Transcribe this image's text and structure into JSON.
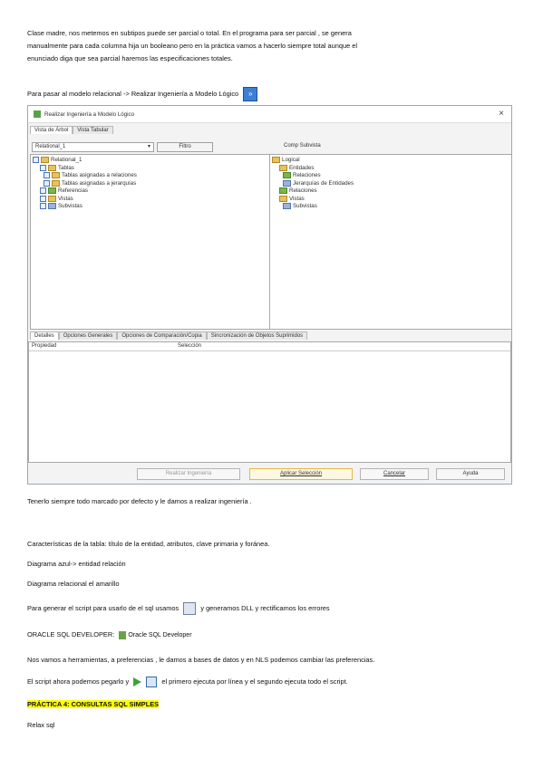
{
  "intro": [
    "Clase madre, nos metemos en subtipos puede ser parcial o total. En el programa para ser parcial , se genera",
    "manualmente para cada columna hija un booleano pero en la práctica vamos a hacerlo siempre total aunque el",
    "enunciado diga que sea parcial haremos las especificaciones totales."
  ],
  "relational_line": "Para pasar al modelo relacional -> Realizar Ingeniería a Modelo Lógico",
  "dialog": {
    "title": "Realizar Ingeniería a Modelo Lógico",
    "close": "×",
    "top_tabs": [
      "Vista de Árbol",
      "Vista Tabular"
    ],
    "left_select": "Relational_1",
    "filter_button": "Filtro",
    "compare_label": "Comp Subvista",
    "left_tree": [
      "Relational_1",
      "Tablas",
      "Tablas asignadas a relaciones",
      "Tablas asignadas a jerarquías",
      "Referencias",
      "Vistas",
      "Subvistas"
    ],
    "right_tree": [
      "Logical",
      "Entidades",
      "Relaciones",
      "Jerarquías de Entidades",
      "Relaciones",
      "Vistas",
      "Subvistas"
    ],
    "bottom_tabs": [
      "Detalles",
      "Opciones Generales",
      "Opciones de Comparación/Copia",
      "Sincronización de Objetos Suprimidos"
    ],
    "col_property": "Propiedad",
    "col_selection": "Selección",
    "buttons": [
      "Realizar Ingeniería",
      "Aplicar Selección",
      "Cancelar",
      "Ayuda"
    ]
  },
  "lines": [
    "Tenerlo siempre todo marcado por defecto y le damos a realizar ingeniería .",
    "Características de la tabla: título de la entidad, atributos, clave primaria y foránea.",
    "Diagrama azul-> entidad relación",
    "Diagrama relacional el amarillo"
  ],
  "script_line_a": "Para generar el script para usarlo de el sql usamos",
  "script_line_b": "y generamos DLL y rectificamos los errores",
  "oracle_label": "ORACLE SQL DEVELOPER:",
  "oracle_badge": "Oracle SQL Developer",
  "prefs_line": "Nos vamos a herramientas, a preferencias , le damos a bases de datos y en NLS podemos cambiar las preferencias.",
  "paste_line_a": "El script ahora podemos pegarlo y",
  "paste_line_b": "el primero ejecuta por línea y el segundo ejecuta todo el script.",
  "heading": "PRÁCTICA 4: CONSULTAS SQL SIMPLES",
  "relax": "Relax sql"
}
